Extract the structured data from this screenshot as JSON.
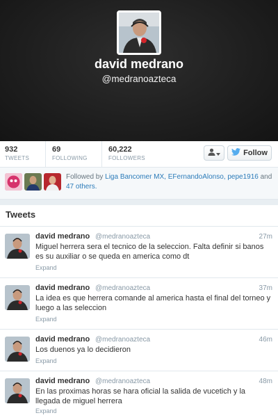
{
  "profile": {
    "name": "david medrano",
    "handle": "@medranoazteca"
  },
  "stats": [
    {
      "value": "932",
      "label": "TWEETS"
    },
    {
      "value": "69",
      "label": "FOLLOWING"
    },
    {
      "value": "60,222",
      "label": "FOLLOWERS"
    }
  ],
  "actions": {
    "user_menu_icon": "user-icon",
    "follow_label": "Follow"
  },
  "followed_by": {
    "prefix": "Followed by",
    "names": "Liga Bancomer MX, EFernandoAlonso, pepe1916",
    "and": "and",
    "others": "47 others."
  },
  "tweets_section": {
    "title": "Tweets"
  },
  "tweets": [
    {
      "name": "david medrano",
      "handle": "@medranoazteca",
      "time": "27m",
      "text": "Miguel herrera sera el tecnico de la seleccion. Falta definir si banos es su auxiliar o se queda en america como dt",
      "expand": "Expand"
    },
    {
      "name": "david medrano",
      "handle": "@medranoazteca",
      "time": "37m",
      "text": "La idea es que herrera comande al america hasta el final del torneo y luego a las seleccion",
      "expand": "Expand"
    },
    {
      "name": "david medrano",
      "handle": "@medranoazteca",
      "time": "46m",
      "text": "Los duenos ya lo decidieron",
      "expand": "Expand"
    },
    {
      "name": "david medrano",
      "handle": "@medranoazteca",
      "time": "48m",
      "text": "En las proximas horas se hara oficial la salida de vucetich y la llegada de miguel herrera",
      "expand": "Expand"
    }
  ],
  "colors": {
    "link": "#2b7bb9",
    "twitter_bird": "#55acee",
    "header_bg": "#1e1e1e"
  }
}
